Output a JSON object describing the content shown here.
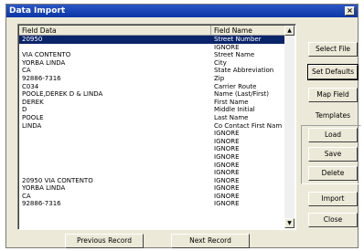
{
  "window": {
    "title": "Data Import",
    "close_label": "×"
  },
  "list": {
    "columns": [
      "Field Data",
      "Field Name"
    ],
    "rows": [
      {
        "data": "20950",
        "name": "Street Number",
        "selected": true
      },
      {
        "data": "",
        "name": "IGNORE"
      },
      {
        "data": "VIA CONTENTO",
        "name": "Street Name"
      },
      {
        "data": "YORBA LINDA",
        "name": "City"
      },
      {
        "data": "CA",
        "name": "State Abbreviation"
      },
      {
        "data": "92886-7316",
        "name": "Zip"
      },
      {
        "data": "C034",
        "name": "Carrier Route"
      },
      {
        "data": "POOLE,DEREK D & LINDA",
        "name": "Name (Last/First)"
      },
      {
        "data": "DEREK",
        "name": "First Name"
      },
      {
        "data": "D",
        "name": "Middle Initial"
      },
      {
        "data": "POOLE",
        "name": "Last Name"
      },
      {
        "data": "LINDA",
        "name": "Co Contact First Nam"
      },
      {
        "data": "",
        "name": "IGNORE"
      },
      {
        "data": "",
        "name": "IGNORE"
      },
      {
        "data": "",
        "name": "IGNORE"
      },
      {
        "data": "",
        "name": "IGNORE"
      },
      {
        "data": "",
        "name": "IGNORE"
      },
      {
        "data": "",
        "name": "IGNORE"
      },
      {
        "data": "20950 VIA CONTENTO",
        "name": "IGNORE"
      },
      {
        "data": "YORBA LINDA",
        "name": "IGNORE"
      },
      {
        "data": "CA",
        "name": "IGNORE"
      },
      {
        "data": "92886-7316",
        "name": "IGNORE"
      }
    ]
  },
  "buttons": {
    "select_file": "Select File",
    "set_defaults": "Set Defaults",
    "map_field": "Map Field",
    "templates_label": "Templates",
    "load": "Load",
    "save": "Save",
    "delete": "Delete",
    "import": "Import",
    "close": "Close",
    "previous_record": "Previous Record",
    "next_record": "Next Record"
  }
}
